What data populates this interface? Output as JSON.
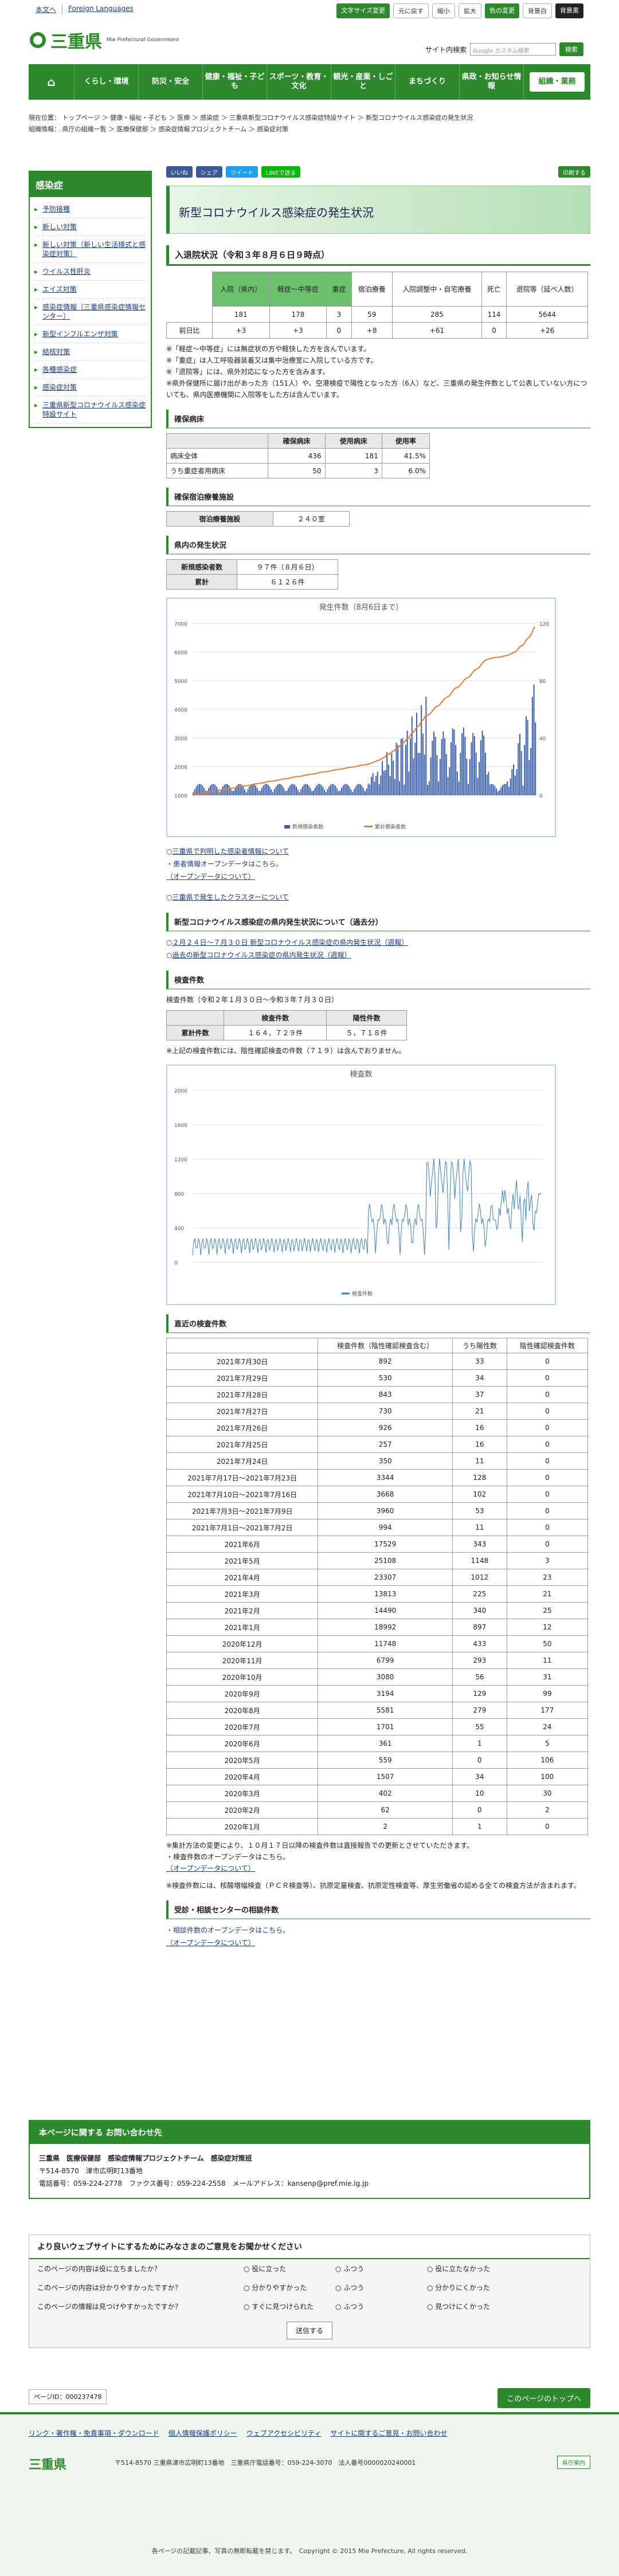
{
  "top": {
    "home": "本文へ",
    "foreign": "Foreign Languages",
    "font_size": "文字サイズ変更",
    "normal": "元に戻す",
    "small": "縮小",
    "large": "拡大",
    "color": "色の変更",
    "c1": "背景白",
    "c2": "背景黒"
  },
  "header": {
    "logo": "三重県",
    "sub": "Mie Prefectural Government",
    "search_label": "サイト内検索",
    "search_placeholder": "Google カスタム検索",
    "search_btn": "検索"
  },
  "nav": [
    "くらし・環境",
    "防災・安全",
    "健康・福祉・子ども",
    "スポーツ・教育・文化",
    "観光・産業・しごと",
    "まちづくり",
    "県政・お知らせ情報",
    "組織・業務"
  ],
  "breadcrumb": {
    "line1": "現在位置： トップページ ＞ 健康・福祉・子ども ＞ 医療 ＞ 感染症 ＞ 三重県新型コロナウイルス感染症特設サイト ＞ 新型コロナウイルス感染症の発生状況",
    "line2": "組織情報： 県庁の組織一覧 ＞ 医療保健部 ＞ 感染症情報プロジェクトチーム ＞ 感染症対策"
  },
  "sidebar": {
    "title": "感染症",
    "items": [
      "予防接種",
      "新しい対策",
      "新しい対策（新しい生活様式と感染症対策）",
      "ウイルス性肝炎",
      "エイズ対策",
      "感染症情報（三重県感染症情報センター）",
      "新型インフルエンザ対策",
      "結核対策",
      "各種感染症",
      "感染症対策",
      "三重県新型コロナウイルス感染症特設サイト"
    ]
  },
  "share": {
    "fb": "いいね",
    "share": "シェア",
    "tw": "ツイート",
    "line": "LINEで送る",
    "print": "印刷する"
  },
  "page_title": "新型コロナウイルス感染症の発生状況",
  "inpatient": {
    "heading": "入退院状況（令和３年８月６日９時点）",
    "headers": [
      "入院（県内）",
      "軽症〜中等症",
      "重症",
      "宿泊療養",
      "入院調整中・自宅療養",
      "死亡",
      "退院等（延べ人数）"
    ],
    "row_label": "前日比",
    "values": [
      "181",
      "178",
      "3",
      "59",
      "285",
      "114",
      "5644"
    ],
    "diffs": [
      "+3",
      "+3",
      "0",
      "+8",
      "+61",
      "0",
      "+26"
    ],
    "notes": [
      "※「軽症〜中等症」には無症状の方や軽快した方を含んでいます。",
      "※「重症」は人工呼吸器装着又は集中治療室に入院している方です。",
      "※「退院等」には、県外対応になった方を含みます。",
      "※県外保健所に届け出があった方（151人）や、空港検疫で陽性となった方（6人）など、三重県の発生件数として公表していない方についても、県内医療機関に入院等をした方は含んでいます。"
    ]
  },
  "beds": {
    "heading": "確保病床",
    "cols": [
      "確保病床",
      "使用病床",
      "使用率"
    ],
    "rows": [
      [
        "病床全体",
        "436",
        "181",
        "41.5%"
      ],
      [
        "うち重症者用病床",
        "50",
        "3",
        "6.0%"
      ]
    ],
    "hotel_heading": "確保宿泊療養施設",
    "hotel_label": "宿泊療養施設",
    "hotel_value": "２４０室"
  },
  "prefecture": {
    "heading": "県内の発生状況",
    "new_label": "新規感染者数",
    "new_value": "９７件（８月６日）",
    "total_label": "累計",
    "total_value": "６１２６件"
  },
  "chart_title": "発生件数（8月6日まで）",
  "links1": [
    "三重県で判明した感染者情報について",
    "・患者情報オープンデータはこちら。",
    "（オープンデータについて）",
    "三重県で発生したクラスターについて"
  ],
  "past": {
    "heading": "新型コロナウイルス感染症の県内発生状況について（過去分）",
    "l1": "２月２４日〜７月３０日 新型コロナウイルス感染症の県内発生状況（週報）",
    "l2": "過去の新型コロナウイルス感染症の県内発生状況（週報）"
  },
  "tests": {
    "heading": "検査件数",
    "period": "検査件数（令和２年１月３０日〜令和３年７月３０日）",
    "cols": [
      "検査件数",
      "陽性件数"
    ],
    "label": "累計件数",
    "count": "１６４，７２９件",
    "positive": "５，７１８件",
    "note": "※上記の検査件数には、陰性確認検査の件数（７１９）は含んでおりません。"
  },
  "chart2_title": "検査数",
  "chart2_legend": "検査件数",
  "recent": {
    "heading": "直近の検査件数",
    "cols": [
      "",
      "検査件数（陰性確認検査含む）",
      "うち陽性数",
      "陰性確認検査件数"
    ],
    "rows": [
      [
        "2021年7月30日",
        "892",
        "33",
        "0"
      ],
      [
        "2021年7月29日",
        "530",
        "34",
        "0"
      ],
      [
        "2021年7月28日",
        "843",
        "37",
        "0"
      ],
      [
        "2021年7月27日",
        "730",
        "21",
        "0"
      ],
      [
        "2021年7月26日",
        "926",
        "16",
        "0"
      ],
      [
        "2021年7月25日",
        "257",
        "16",
        "0"
      ],
      [
        "2021年7月24日",
        "350",
        "11",
        "0"
      ],
      [
        "2021年7月17日〜2021年7月23日",
        "3344",
        "128",
        "0"
      ],
      [
        "2021年7月10日〜2021年7月16日",
        "3668",
        "102",
        "0"
      ],
      [
        "2021年7月3日〜2021年7月9日",
        "3960",
        "53",
        "0"
      ],
      [
        "2021年7月1日〜2021年7月2日",
        "994",
        "11",
        "0"
      ],
      [
        "2021年6月",
        "17529",
        "343",
        "0"
      ],
      [
        "2021年5月",
        "25108",
        "1148",
        "3"
      ],
      [
        "2021年4月",
        "23307",
        "1012",
        "23"
      ],
      [
        "2021年3月",
        "13813",
        "225",
        "21"
      ],
      [
        "2021年2月",
        "14490",
        "340",
        "25"
      ],
      [
        "2021年1月",
        "18992",
        "897",
        "12"
      ],
      [
        "2020年12月",
        "11748",
        "433",
        "50"
      ],
      [
        "2020年11月",
        "6799",
        "293",
        "11"
      ],
      [
        "2020年10月",
        "3080",
        "56",
        "31"
      ],
      [
        "2020年9月",
        "3194",
        "129",
        "99"
      ],
      [
        "2020年8月",
        "5581",
        "279",
        "177"
      ],
      [
        "2020年7月",
        "1701",
        "55",
        "24"
      ],
      [
        "2020年6月",
        "361",
        "1",
        "5"
      ],
      [
        "2020年5月",
        "559",
        "0",
        "106"
      ],
      [
        "2020年4月",
        "1507",
        "34",
        "100"
      ],
      [
        "2020年3月",
        "402",
        "10",
        "30"
      ],
      [
        "2020年2月",
        "62",
        "0",
        "2"
      ],
      [
        "2020年1月",
        "2",
        "1",
        "0"
      ]
    ],
    "notes": [
      "※集計方法の変更により、１０月１７日以降の検査件数は直接報告での更新とさせていただきます。",
      "・検査件数のオープンデータはこちら。",
      "（オープンデータについて）",
      "※検査件数には、核酸増幅検査（ＰＣＲ検査等）、抗原定量検査、抗原定性検査等、厚生労働省の認める全ての検査方法が含まれます。"
    ]
  },
  "consult": {
    "heading": "受診・相談センターの相談件数",
    "l1": "・相談件数のオープンデータはこちら。",
    "l2": "（オープンデータについて）"
  },
  "contact": {
    "title": "本ページに関する お問い合わせ先",
    "org": "三重県　医療保健部　感染症情報プロジェクトチーム　感染症対策班",
    "addr": "〒514-8570　津市広明町13番地",
    "tel": "電話番号：059-224-2778　ファクス番号：059-224-2558　メールアドレス：kansenp@pref.mie.lg.jp"
  },
  "survey": {
    "title": "より良いウェブサイトにするためにみなさまのご意見をお聞かせください",
    "rows": [
      [
        "このページの内容は役に立ちましたか？",
        "役に立った",
        "ふつう",
        "役に立たなかった"
      ],
      [
        "このページの内容は分かりやすかったですか？",
        "分かりやすかった",
        "ふつう",
        "分かりにくかった"
      ],
      [
        "このページの情報は見つけやすかったですか？",
        "すぐに見つけられた",
        "ふつう",
        "見つけにくかった"
      ]
    ],
    "send": "送信する"
  },
  "page_id": "ページID：000237478",
  "to_top": "このページのトップへ",
  "footer": {
    "links": [
      "リンク・著作権・免責事項・ダウンロード",
      "個人情報保護ポリシー",
      "ウェブアクセシビリティ",
      "サイトに関するご意見・お問い合わせ"
    ],
    "logo": "三重県",
    "addr": "〒514-8570 三重県津市広明町13番地　三重県庁電話番号：059-224-3070　法人番号0000020240001",
    "access": "県庁案内",
    "copy": "各ページの記載記事、写真の無断転載を禁じます。　Copyright © 2015 Mie Prefecture, All rights reserved."
  },
  "chart_data": [
    {
      "type": "bar",
      "title": "発生件数（8月6日まで）",
      "legend": [
        "新規感染者数",
        "累計感染者数"
      ],
      "ylim": [
        0,
        7000
      ],
      "y2lim": [
        0,
        120
      ],
      "note": "daily bars + cumulative line, peaks ~100 in 2021-05 and ~97 on 2021-08-06"
    },
    {
      "type": "line",
      "title": "検査数",
      "legend": [
        "検査件数"
      ],
      "ylim": [
        0,
        2000
      ]
    }
  ]
}
